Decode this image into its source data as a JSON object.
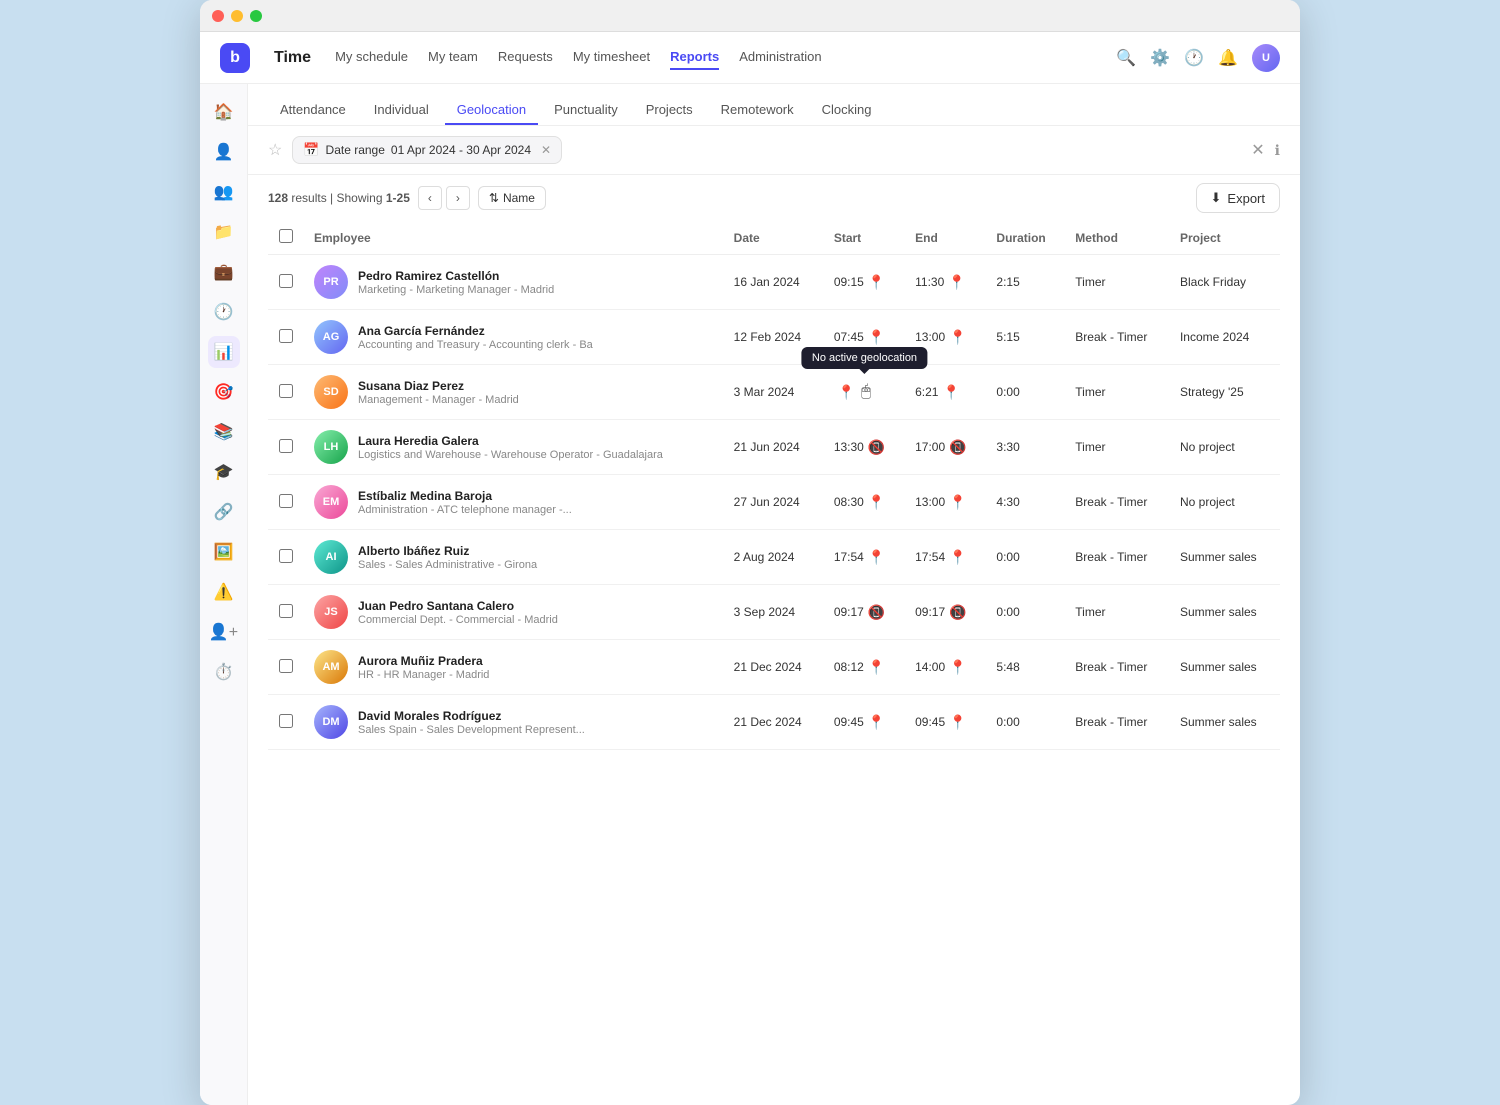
{
  "app": {
    "logo": "b",
    "name": "Time"
  },
  "topnav": {
    "items": [
      {
        "label": "My schedule",
        "active": false
      },
      {
        "label": "My team",
        "active": false
      },
      {
        "label": "Requests",
        "active": false
      },
      {
        "label": "My timesheet",
        "active": false
      },
      {
        "label": "Reports",
        "active": true
      },
      {
        "label": "Administration",
        "active": false
      }
    ]
  },
  "report_tabs": [
    {
      "label": "Attendance",
      "active": false
    },
    {
      "label": "Individual",
      "active": false
    },
    {
      "label": "Geolocation",
      "active": true
    },
    {
      "label": "Punctuality",
      "active": false
    },
    {
      "label": "Projects",
      "active": false
    },
    {
      "label": "Remotework",
      "active": false
    },
    {
      "label": "Clocking",
      "active": false
    }
  ],
  "filter": {
    "date_label": "Date range",
    "date_value": "01 Apr 2024 - 30 Apr 2024"
  },
  "results": {
    "total": "128",
    "showing": "1-25",
    "sort_label": "Name",
    "export_label": "Export"
  },
  "table_headers": [
    "Employee",
    "Date",
    "Start",
    "End",
    "Duration",
    "Method",
    "Project"
  ],
  "tooltip": "No active geolocation",
  "rows": [
    {
      "name": "Pedro Ramirez Castellón",
      "dept": "Marketing - Marketing Manager - Madrid",
      "date": "16 Jan 2024",
      "start": "09:15",
      "end": "11:30",
      "duration": "2:15",
      "method": "Timer",
      "project": "Black Friday",
      "start_geo": true,
      "end_geo": true,
      "show_tooltip": false,
      "initials": "PR",
      "avatar_class": "av-purple"
    },
    {
      "name": "Ana García Fernández",
      "dept": "Accounting and Treasury - Accounting clerk - Ba",
      "date": "12 Feb 2024",
      "start": "07:45",
      "end": "13:00",
      "duration": "5:15",
      "method": "Break - Timer",
      "project": "Income 2024",
      "start_geo": true,
      "end_geo": true,
      "show_tooltip": false,
      "initials": "AG",
      "avatar_class": "av-blue"
    },
    {
      "name": "Susana Diaz Perez",
      "dept": "Management - Manager - Madrid",
      "date": "3 Mar 2024",
      "start": "",
      "end": "6:21",
      "duration": "0:00",
      "method": "Timer",
      "project": "Strategy '25",
      "start_geo": false,
      "end_geo": true,
      "show_tooltip": true,
      "initials": "SD",
      "avatar_class": "av-orange"
    },
    {
      "name": "Laura Heredia Galera",
      "dept": "Logistics and Warehouse - Warehouse Operator - Guadalajara",
      "date": "21 Jun 2024",
      "start": "13:30",
      "end": "17:00",
      "duration": "3:30",
      "method": "Timer",
      "project": "No project",
      "start_geo": false,
      "end_geo": false,
      "show_tooltip": false,
      "initials": "LH",
      "avatar_class": "av-green"
    },
    {
      "name": "Estíbaliz Medina Baroja",
      "dept": "Administration - ATC telephone manager -...",
      "date": "27 Jun 2024",
      "start": "08:30",
      "end": "13:00",
      "duration": "4:30",
      "method": "Break - Timer",
      "project": "No project",
      "start_geo": true,
      "end_geo": true,
      "show_tooltip": false,
      "initials": "EM",
      "avatar_class": "av-pink"
    },
    {
      "name": "Alberto Ibáñez Ruiz",
      "dept": "Sales - Sales Administrative - Girona",
      "date": "2 Aug 2024",
      "start": "17:54",
      "end": "17:54",
      "duration": "0:00",
      "method": "Break - Timer",
      "project": "Summer sales",
      "start_geo": true,
      "end_geo": true,
      "show_tooltip": false,
      "initials": "AI",
      "avatar_class": "av-teal"
    },
    {
      "name": "Juan Pedro Santana Calero",
      "dept": "Commercial Dept. - Commercial - Madrid",
      "date": "3 Sep 2024",
      "start": "09:17",
      "end": "09:17",
      "duration": "0:00",
      "method": "Timer",
      "project": "Summer sales",
      "start_geo": false,
      "end_geo": false,
      "show_tooltip": false,
      "initials": "JS",
      "avatar_class": "av-red"
    },
    {
      "name": "Aurora Muñiz Pradera",
      "dept": "HR - HR Manager - Madrid",
      "date": "21 Dec 2024",
      "start": "08:12",
      "end": "14:00",
      "duration": "5:48",
      "method": "Break - Timer",
      "project": "Summer sales",
      "start_geo": true,
      "end_geo": true,
      "show_tooltip": false,
      "initials": "AM",
      "avatar_class": "av-yellow"
    },
    {
      "name": "David Morales Rodríguez",
      "dept": "Sales Spain - Sales Development Represent...",
      "date": "21 Dec 2024",
      "start": "09:45",
      "end": "09:45",
      "duration": "0:00",
      "method": "Break - Timer",
      "project": "Summer sales",
      "start_geo": true,
      "end_geo": true,
      "show_tooltip": false,
      "initials": "DM",
      "avatar_class": "av-indigo"
    }
  ]
}
